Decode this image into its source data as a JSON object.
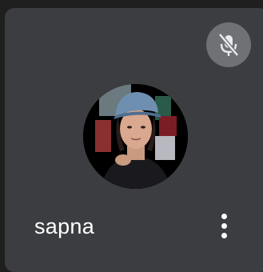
{
  "participant": {
    "name": "sapna",
    "mic_state_icon": "mic-off-icon",
    "avatar_icon": "profile-photo",
    "more_options_icon": "more-vert-icon"
  },
  "colors": {
    "tile_bg": "#3c3d40",
    "mute_button_bg": "#707174",
    "text": "#ffffff"
  }
}
